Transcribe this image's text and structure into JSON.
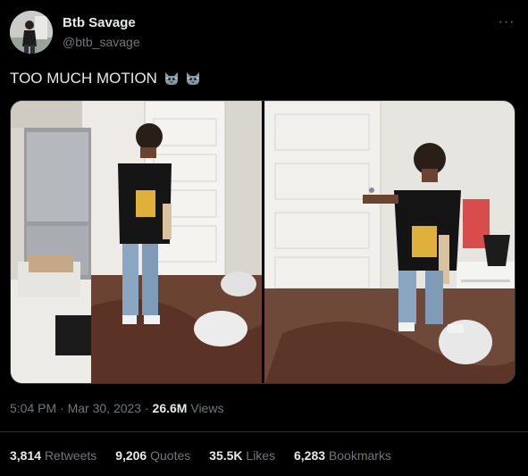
{
  "author": {
    "display_name": "Btb Savage",
    "handle": "@btb_savage",
    "avatar_icon": "profile-photo"
  },
  "more_icon": "more-horizontal-icon",
  "more_label": "···",
  "tweet": {
    "text": "TOO MUCH MOTION",
    "emojis": [
      "cat-face-emoji",
      "cat-face-emoji"
    ]
  },
  "media": {
    "count": 2,
    "photos": [
      {
        "name": "photo-left-kitchen"
      },
      {
        "name": "photo-right-doorway"
      }
    ]
  },
  "meta": {
    "time": "5:04 PM",
    "sep1": "·",
    "date": "Mar 30, 2023",
    "sep2": "·",
    "views_count": "26.6M",
    "views_label": "Views"
  },
  "stats": {
    "retweets": {
      "count": "3,814",
      "label": "Retweets"
    },
    "quotes": {
      "count": "9,206",
      "label": "Quotes"
    },
    "likes": {
      "count": "35.5K",
      "label": "Likes"
    },
    "bookmarks": {
      "count": "6,283",
      "label": "Bookmarks"
    }
  },
  "colors": {
    "background": "#000000",
    "text_primary": "#e7e9ea",
    "text_secondary": "#71767b",
    "border": "#2f3336"
  }
}
